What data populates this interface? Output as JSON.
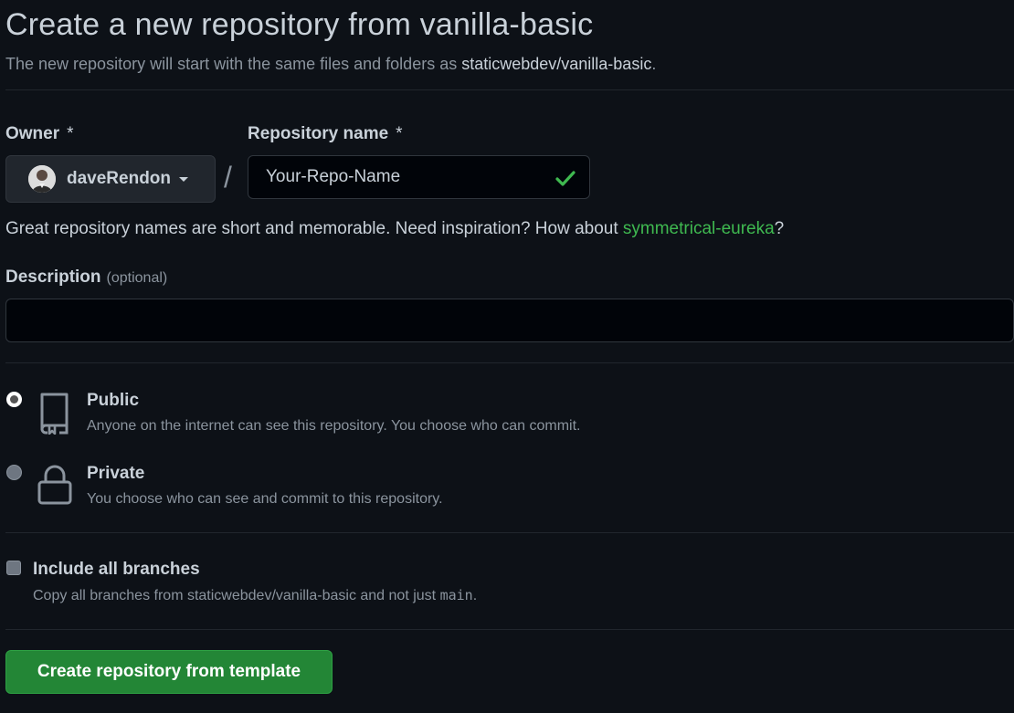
{
  "header": {
    "title": "Create a new repository from vanilla-basic",
    "subtitle_prefix": "The new repository will start with the same files and folders as ",
    "template_repo": "staticwebdev/vanilla-basic",
    "subtitle_suffix": "."
  },
  "owner": {
    "label": "Owner",
    "required_mark": "*",
    "value": "daveRendon"
  },
  "separator": "/",
  "repository_name": {
    "label": "Repository name",
    "required_mark": "*",
    "value": "Your-Repo-Name",
    "valid_color": "#3fb950"
  },
  "hint": {
    "prefix": "Great repository names are short and memorable. Need inspiration? How about ",
    "suggestion": "symmetrical-eureka",
    "suffix": "?"
  },
  "description": {
    "label": "Description",
    "optional_text": "(optional)",
    "value": ""
  },
  "visibility": {
    "selected": "public",
    "options": [
      {
        "key": "public",
        "title": "Public",
        "description": "Anyone on the internet can see this repository. You choose who can commit.",
        "icon": "repo-book-icon"
      },
      {
        "key": "private",
        "title": "Private",
        "description": "You choose who can see and commit to this repository.",
        "icon": "lock-icon"
      }
    ]
  },
  "include_branches": {
    "label": "Include all branches",
    "checked": false,
    "description_prefix": "Copy all branches from staticwebdev/vanilla-basic and not just ",
    "branch_name": "main",
    "description_suffix": "."
  },
  "submit": {
    "label": "Create repository from template"
  },
  "colors": {
    "background": "#0d1117",
    "accent_green": "#238636",
    "link_green": "#3fb950",
    "text": "#c9d1d9",
    "muted": "#8b949e"
  }
}
